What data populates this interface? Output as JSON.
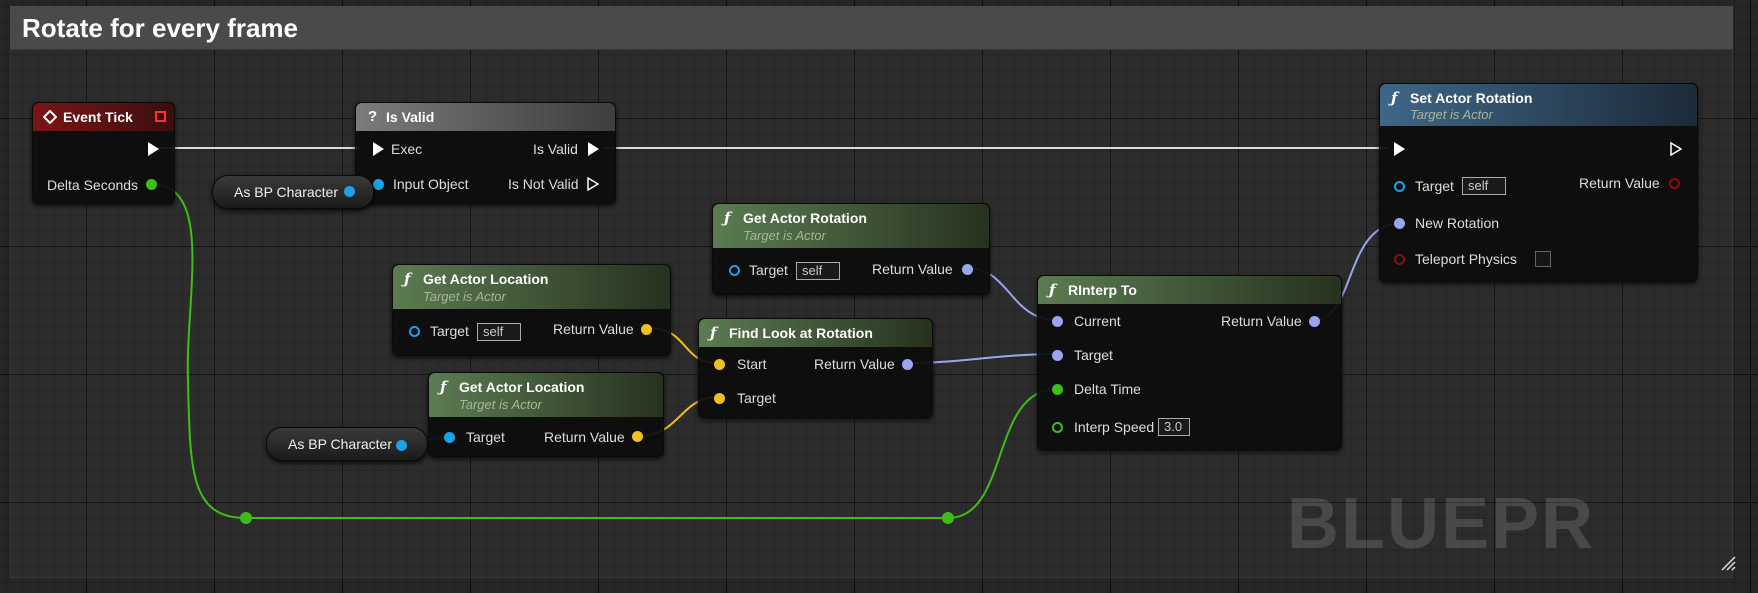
{
  "comment": {
    "title": "Rotate for every frame"
  },
  "watermark": "BLUEPR",
  "colors": {
    "exec": "#ffffff",
    "float": "#3dbd1a",
    "object": "#1aa3e8",
    "vector": "#f0c020",
    "rotator": "#9aa5f0",
    "bool": "#8a0e0e"
  },
  "nodes": {
    "event_tick": {
      "title": "Event Tick",
      "out_delta": "Delta Seconds",
      "icon": "event-diamond-icon"
    },
    "is_valid": {
      "title": "Is Valid",
      "in_exec": "Exec",
      "in_object": "Input Object",
      "out_valid": "Is Valid",
      "out_not_valid": "Is Not Valid",
      "icon": "question-icon"
    },
    "cast1": {
      "label": "As BP Character"
    },
    "cast2": {
      "label": "As BP Character"
    },
    "get_actor_rotation": {
      "title": "Get Actor Rotation",
      "subtitle": "Target is Actor",
      "target": "Target",
      "target_value": "self",
      "ret": "Return Value"
    },
    "get_actor_location1": {
      "title": "Get Actor Location",
      "subtitle": "Target is Actor",
      "target": "Target",
      "target_value": "self",
      "ret": "Return Value"
    },
    "get_actor_location2": {
      "title": "Get Actor Location",
      "subtitle": "Target is Actor",
      "target": "Target",
      "ret": "Return Value"
    },
    "find_look": {
      "title": "Find Look at Rotation",
      "start": "Start",
      "target": "Target",
      "ret": "Return Value"
    },
    "rinterp": {
      "title": "RInterp To",
      "current": "Current",
      "target": "Target",
      "delta": "Delta Time",
      "speed": "Interp Speed",
      "speed_value": "3.0",
      "ret": "Return Value"
    },
    "set_actor_rotation": {
      "title": "Set Actor Rotation",
      "subtitle": "Target is Actor",
      "target": "Target",
      "target_value": "self",
      "new_rot": "New Rotation",
      "teleport": "Teleport Physics",
      "ret": "Return Value"
    }
  }
}
